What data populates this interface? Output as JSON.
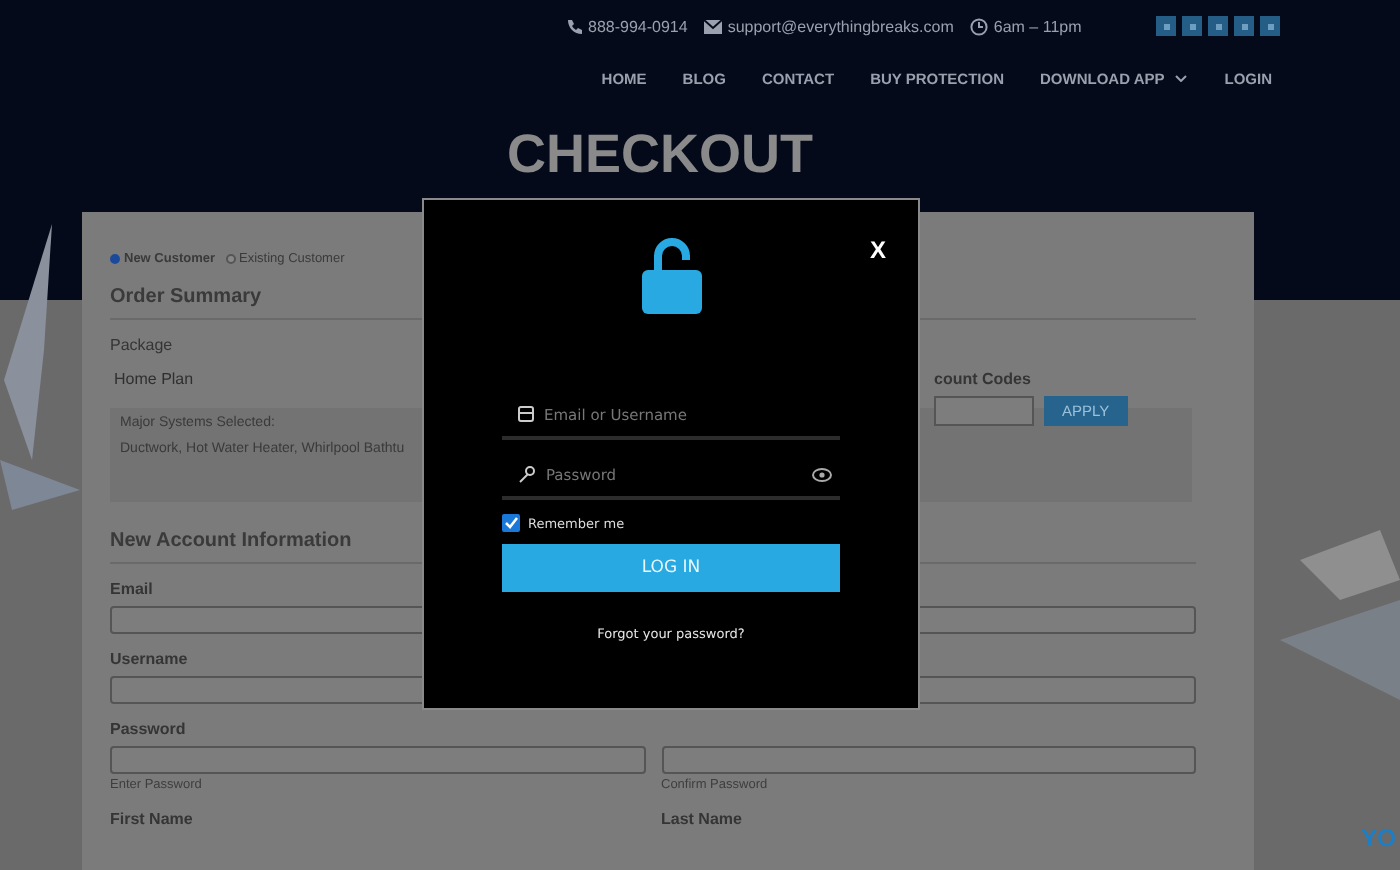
{
  "top_bar": {
    "phone": "888-994-0914",
    "email": "support@everythingbreaks.com",
    "hours": "6am – 11pm"
  },
  "nav": [
    {
      "label": "HOME",
      "dropdown": false
    },
    {
      "label": "BLOG",
      "dropdown": false
    },
    {
      "label": "CONTACT",
      "dropdown": false
    },
    {
      "label": "BUY PROTECTION",
      "dropdown": false
    },
    {
      "label": "DOWNLOAD APP",
      "dropdown": true
    },
    {
      "label": "LOGIN",
      "dropdown": false
    }
  ],
  "page_title": "CHECKOUT",
  "customer_type": [
    {
      "label": "New Customer",
      "selected": true
    },
    {
      "label": "Existing Customer",
      "selected": false
    }
  ],
  "order_summary": {
    "heading": "Order Summary",
    "package_label": "Package",
    "package": "Home Plan",
    "systems_label": "Major Systems Selected:",
    "systems": "Ductwork, Hot Water Heater, Whirlpool Bathtu"
  },
  "discount": {
    "label": "count Codes",
    "button": "APPLY"
  },
  "account": {
    "heading": "New Account Information",
    "email_label": "Email",
    "username_label": "Username",
    "password_label": "Password",
    "password_hint": "Enter Password",
    "confirm_hint": "Confirm Password",
    "first_name_label": "First Name",
    "last_name_label": "Last Name"
  },
  "login_modal": {
    "close": "X",
    "email_placeholder": "Email or Username",
    "password_placeholder": "Password",
    "remember": {
      "label": "Remember me",
      "checked": true
    },
    "button": "LOG IN",
    "forgot": "Forgot your password?"
  },
  "corner_logo": "YO"
}
